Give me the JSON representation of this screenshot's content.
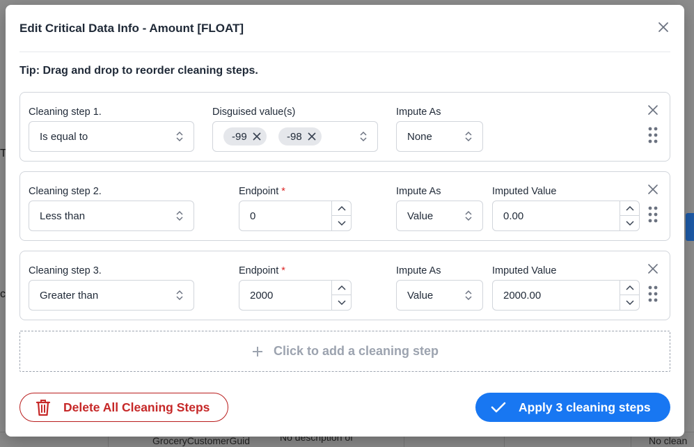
{
  "modal": {
    "title": "Edit Critical Data Info - Amount [FLOAT]",
    "tip": "Tip: Drag and drop to reorder cleaning steps."
  },
  "steps": [
    {
      "label": "Cleaning step 1.",
      "condition": "Is equal to",
      "values_label": "Disguised value(s)",
      "chips": [
        "-99",
        "-98"
      ],
      "impute_label": "Impute As",
      "impute": "None"
    },
    {
      "label": "Cleaning step 2.",
      "condition": "Less than",
      "endpoint_label": "Endpoint",
      "endpoint_required": "*",
      "endpoint": "0",
      "impute_label": "Impute As",
      "impute": "Value",
      "imputed_label": "Imputed Value",
      "imputed": "0.00"
    },
    {
      "label": "Cleaning step 3.",
      "condition": "Greater than",
      "endpoint_label": "Endpoint",
      "endpoint_required": "*",
      "endpoint": "2000",
      "impute_label": "Impute As",
      "impute": "Value",
      "imputed_label": "Imputed Value",
      "imputed": "2000.00"
    }
  ],
  "add_step": {
    "label": "Click to add a cleaning step"
  },
  "footer": {
    "delete_label": "Delete All Cleaning Steps",
    "apply_label": "Apply 3 cleaning steps"
  },
  "background": {
    "row_cells": [
      "GroceryCustomerGuid",
      "No description of",
      "No clean"
    ]
  },
  "colors": {
    "primary": "#1877f2",
    "danger": "#c62828",
    "required": "#dc2626",
    "border": "#d1d5db"
  }
}
